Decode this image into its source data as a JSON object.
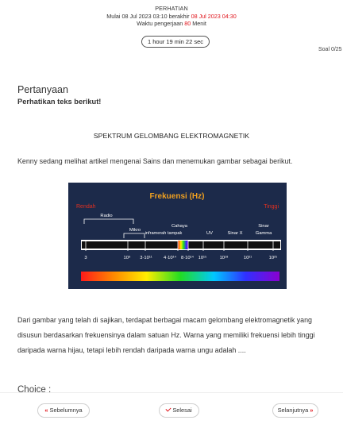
{
  "header": {
    "title": "PERHATIAN",
    "start_prefix": "Mulai ",
    "start_time": "08 Jul 2023 03:10",
    "end_prefix": " berakhir ",
    "end_time": "08 Jul 2023 04:30",
    "duration_prefix": "Waktu pengerjaan ",
    "duration_value": "80",
    "duration_suffix": " Menit"
  },
  "timer": "1 hour 19 min 22 sec",
  "soal": "Soal 0/25",
  "question": {
    "title": "Pertanyaan",
    "subtitle": "Perhatikan teks berikut!",
    "heading": "SPEKTRUM GELOMBANG ELEKTROMAGNETIK",
    "intro": "Kenny sedang melihat artikel mengenai Sains dan menemukan gambar sebagai berikut.",
    "body": "Dari gambar yang telah di sajikan, terdapat berbagai macam gelombang elektromagnetik yang disusun berdasarkan frekuensinya dalam satuan Hz. Warna yang memiliki frekuensi lebih tinggi daripada warna hijau, tetapi lebih rendah daripada warna ungu adalah ....",
    "choice_label": "Choice :"
  },
  "spectrum_image": {
    "title": "Frekuensi (Hz)",
    "low": "Rendah",
    "high": "Tinggi",
    "bands": {
      "radio": "Radio",
      "micro": "Mikro",
      "cahaya": "Cahaya",
      "infra": "inframerah tampak",
      "uv": "UV",
      "xray": "Sinar X",
      "gamma_1": "Sinar",
      "gamma_2": "Gamma"
    },
    "ticks": [
      "3",
      "10⁹",
      "3·10¹¹",
      "4·10¹⁴",
      "8·10¹⁴",
      "10¹⁵",
      "10¹⁸",
      "10²¹",
      "10²⁵"
    ],
    "colors": {
      "background": "#1c2a4a",
      "title": "#f0a020",
      "edge_labels": "#e03020"
    }
  },
  "nav": {
    "prev_label": "Sebelumnya",
    "done_label": "Selesai",
    "next_label": "Selanjutnya"
  },
  "colors": {
    "accent_red": "#e0141b"
  }
}
